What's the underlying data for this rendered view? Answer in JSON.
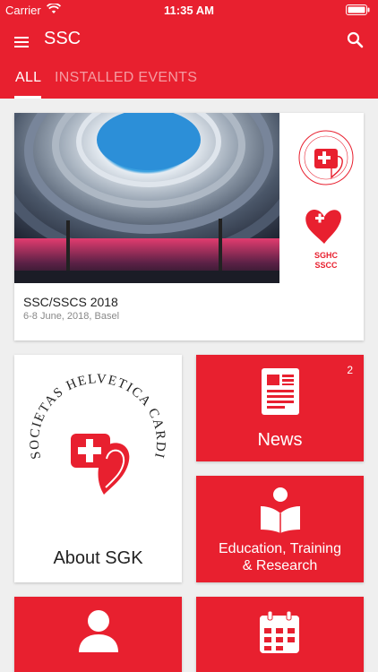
{
  "status": {
    "carrier": "Carrier",
    "time": "11:35 AM"
  },
  "header": {
    "title": "SSC"
  },
  "tabs": [
    {
      "label": "ALL"
    },
    {
      "label": "INSTALLED EVENTS"
    }
  ],
  "event": {
    "title": "SSC/SSCS 2018",
    "subtitle": "6-8 June, 2018, Basel",
    "logo_text": [
      "SGHC",
      "SSCC"
    ]
  },
  "tiles": {
    "about": {
      "label": "About SGK",
      "logo_text": "SOCIETAS HELVETICA CARDIOLOGICA"
    },
    "news": {
      "label": "News",
      "badge": "2"
    },
    "education": {
      "label_line1": "Education, Training",
      "label_line2": "& Research"
    }
  },
  "colors": {
    "brand_red": "#e8202f",
    "background": "#efefef"
  },
  "icons": [
    "menu-icon",
    "search-icon",
    "wifi-icon",
    "battery-icon",
    "newspaper-icon",
    "reading-person-icon",
    "person-icon",
    "calendar-icon"
  ]
}
